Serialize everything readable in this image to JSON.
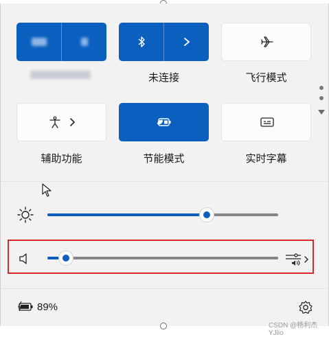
{
  "tiles": {
    "wifi": {
      "network_label": ""
    },
    "bluetooth": {
      "label": "未连接"
    },
    "airplane": {
      "label": "飞行模式"
    },
    "accessibility": {
      "label": "辅助功能"
    },
    "energy_saver": {
      "label": "节能模式"
    },
    "live_captions": {
      "label": "实时字幕"
    }
  },
  "brightness": {
    "level": 0.69
  },
  "volume": {
    "level": 0.08
  },
  "battery": {
    "percent_text": "89%"
  },
  "watermark": {
    "text": "CSDN @杨利杰YJlio"
  },
  "colors": {
    "accent": "#0a5fbf",
    "highlight_border": "#d9262b",
    "panel_bg": "#f2f2f2"
  }
}
